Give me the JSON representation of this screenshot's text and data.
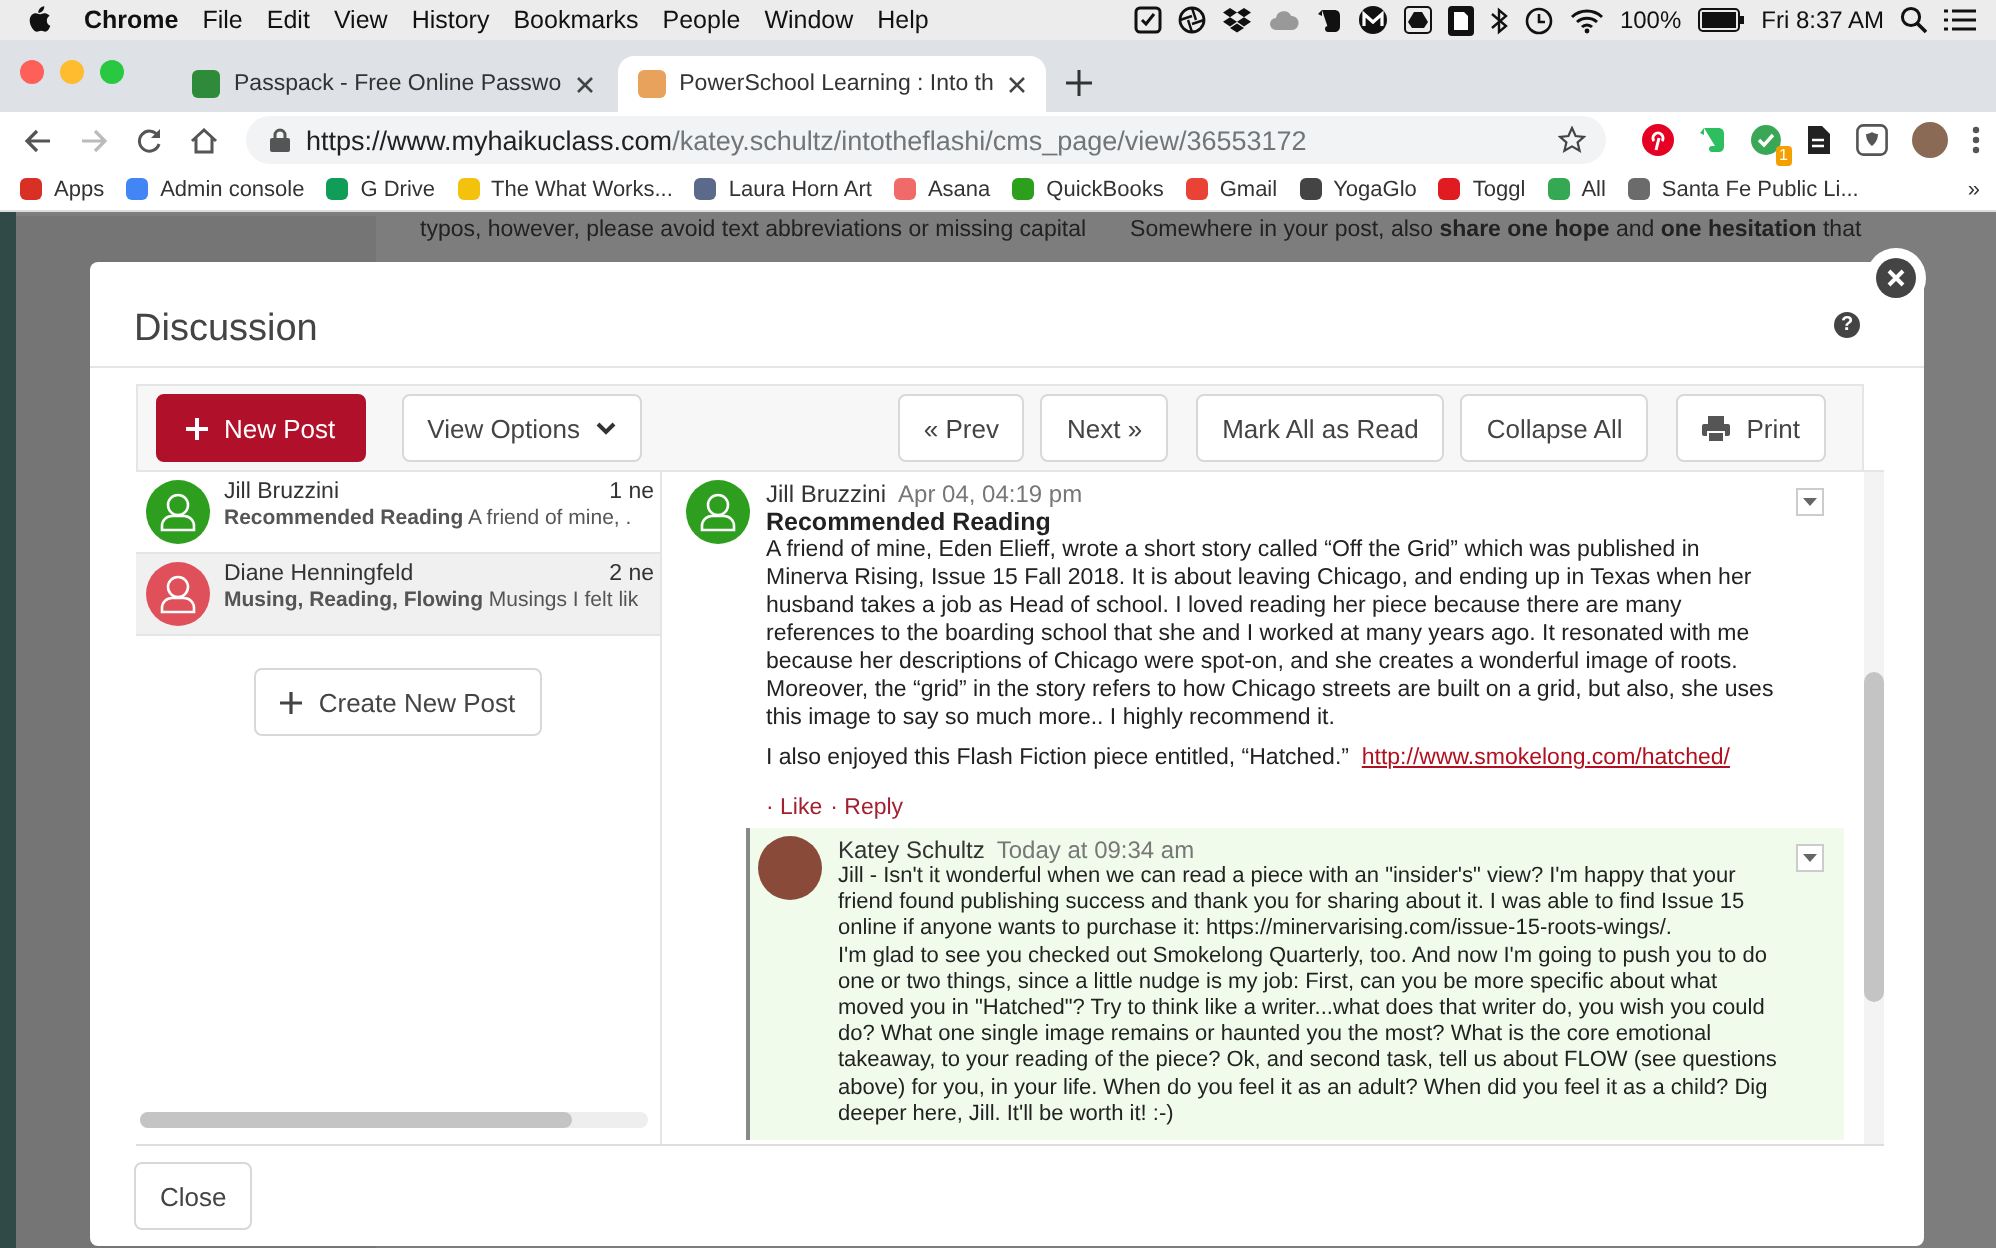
{
  "menu_bar": {
    "app": "Chrome",
    "menus": [
      "File",
      "Edit",
      "View",
      "History",
      "Bookmarks",
      "People",
      "Window",
      "Help"
    ],
    "battery": "100%",
    "clock": "Fri 8:37 AM"
  },
  "tabs": [
    {
      "title": "Passpack - Free Online Passwo",
      "selected": false,
      "color": "#2e8b3a"
    },
    {
      "title": "PowerSchool Learning : Into th",
      "selected": true,
      "color": "#e8a25c"
    }
  ],
  "address_bar": {
    "url_host": "https://www.myhaikuclass.com",
    "url_path": "/katey.schultz/intotheflashi/cms_page/view/36553172",
    "extension_badge": "1"
  },
  "bookmarks": [
    {
      "label": "Apps",
      "color": "#d93025"
    },
    {
      "label": "Admin console",
      "color": "#4285f4"
    },
    {
      "label": "G Drive",
      "color": "#0f9d58"
    },
    {
      "label": "The What Works...",
      "color": "#f4c20d"
    },
    {
      "label": "Laura Horn Art",
      "color": "#5b6a8a"
    },
    {
      "label": "Asana",
      "color": "#f06a6a"
    },
    {
      "label": "QuickBooks",
      "color": "#2ca01c"
    },
    {
      "label": "Gmail",
      "color": "#ea4335"
    },
    {
      "label": "YogaGlo",
      "color": "#444444"
    },
    {
      "label": "Toggl",
      "color": "#e01b22"
    },
    {
      "label": "All",
      "color": "#34a853"
    },
    {
      "label": "Santa Fe Public Li...",
      "color": "#6b6b6b"
    }
  ],
  "bookmarks_overflow": "»",
  "background_page": {
    "left_text": "typos, however, please avoid text abbreviations or missing capital",
    "right_text": "Somewhere in your post, also **share one hope** and **one hesitation** that"
  },
  "dialog": {
    "title": "Discussion",
    "help": "?",
    "toolbar": {
      "new_post": "New Post",
      "view_options": "View Options",
      "prev": "« Prev",
      "next": "Next »",
      "mark_all_read": "Mark All as Read",
      "collapse_all": "Collapse All",
      "print": "Print"
    },
    "threads": [
      {
        "author": "Jill Bruzzini",
        "count": "1 ne",
        "summary": "**Recommended Reading** A friend of mine, .",
        "color": "#2e9e1f",
        "selected": false
      },
      {
        "author": "Diane Henningfeld",
        "count": "2 ne",
        "summary": "**Musing, Reading, Flowing** Musings I felt lik",
        "color": "#e0505a",
        "selected": true
      }
    ],
    "create_post": "Create New Post",
    "post": {
      "author": "Jill Bruzzini",
      "date": "Apr 04, 04:19 pm",
      "title": "Recommended Reading",
      "body": "A friend of mine, Eden Elieff, wrote a short story called “Off the Grid” which was published in Minerva Rising, Issue 15 Fall 2018.   It is about leaving Chicago, and ending up in Texas when her husband takes a job as Head of school. I loved reading her piece because there are many references to the boarding school that she and I worked at many years ago.  It resonated with me because her descriptions of Chicago were spot-on, and she creates a wonderful image of roots. Moreover, the “grid” in the story refers to how Chicago streets are built on a grid, but also, she uses this image to say so much more..  I highly recommend it.",
      "link_intro": "I also enjoyed this Flash Fiction piece entitled, “Hatched.”",
      "link": "http://www.smokelong.com/hatched/",
      "actions": [
        "· Like",
        "· Reply"
      ],
      "reply": {
        "author": "Katey Schultz",
        "date": "Today at 09:34 am",
        "paragraphs": [
          "Jill - Isn't it wonderful when we can read a piece with an \"insider's\" view? I'm happy that your friend found publishing success and thank you for sharing about it. I was able to find Issue 15 online if anyone wants to purchase it: https://minervarising.com/issue-15-roots-wings/.",
          "I'm glad to see you checked out Smokelong Quarterly, too. And now I'm going to push you to do one or two things, since a little nudge is my job: First, can you be more specific about what moved you in \"Hatched\"? Try to think like a writer...what does that writer do, you wish you could do? What one single image remains or haunted you the most? What is the core emotional takeaway, to your reading of the piece? Ok, and second task, tell us about FLOW (see questions above) for you, in your life. When do you feel it as an adult? When did you feel it as a child? Dig deeper here, Jill. It'll be worth it! :-)"
        ]
      }
    },
    "close": "Close"
  }
}
